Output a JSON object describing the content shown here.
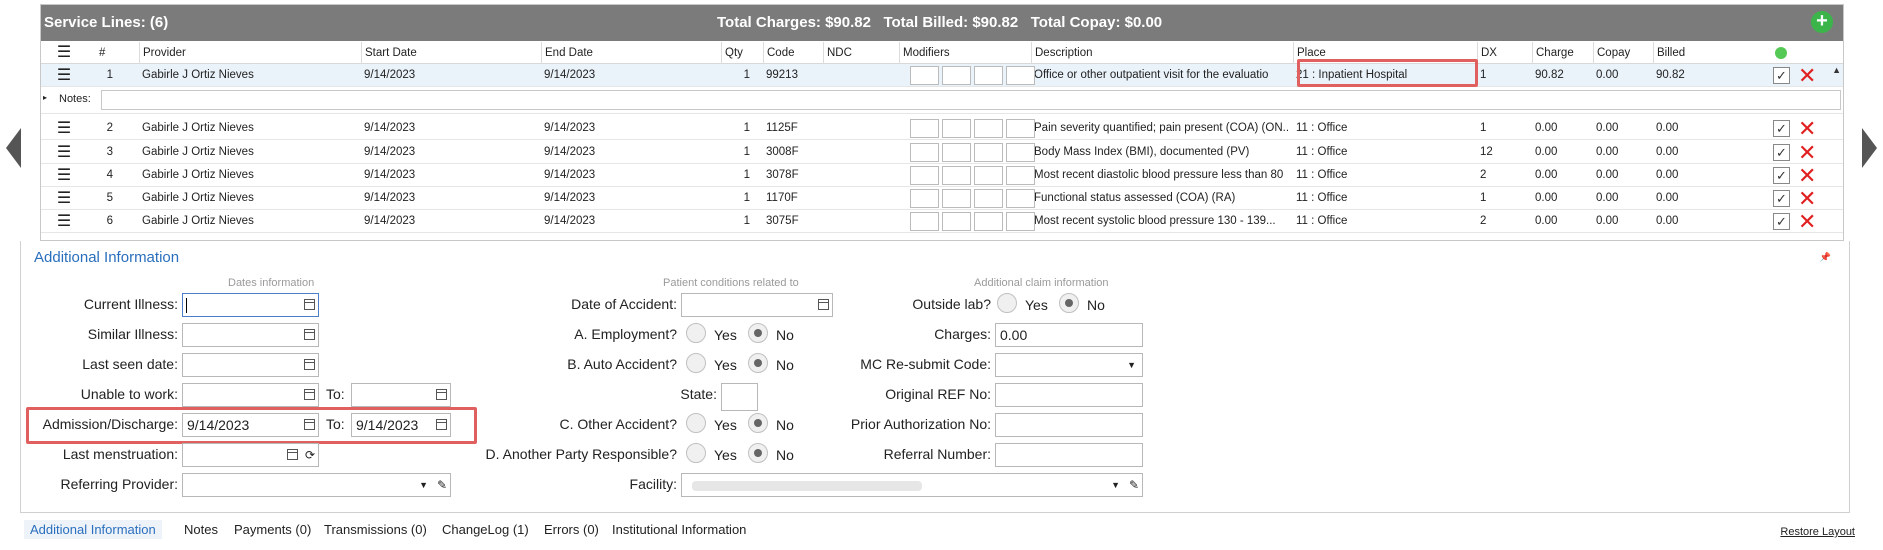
{
  "service_lines": {
    "title": "Service Lines: (6)",
    "totals": "Total Charges: $90.82   Total Billed: $90.82   Total Copay: $0.00",
    "add_symbol": "+",
    "columns": [
      "#",
      "Provider",
      "Start Date",
      "End Date",
      "Qty",
      "Code",
      "NDC",
      "Modifiers",
      "Description",
      "Place",
      "DX",
      "Charge",
      "Copay",
      "Billed"
    ],
    "notes_label": "Notes:",
    "rows": [
      {
        "num": "1",
        "provider": "Gabirle J Ortiz Nieves",
        "start": "9/14/2023",
        "end": "9/14/2023",
        "qty": "1",
        "code": "99213",
        "ndc": "",
        "description": "Office or other outpatient visit for the evaluatio",
        "place": "21 : Inpatient Hospital",
        "dx": "1",
        "charge": "90.82",
        "copay": "0.00",
        "billed": "90.82"
      },
      {
        "num": "2",
        "provider": "Gabirle J Ortiz Nieves",
        "start": "9/14/2023",
        "end": "9/14/2023",
        "qty": "1",
        "code": "1125F",
        "ndc": "",
        "description": "Pain severity quantified; pain present (COA) (ON...",
        "place": "11 : Office",
        "dx": "1",
        "charge": "0.00",
        "copay": "0.00",
        "billed": "0.00"
      },
      {
        "num": "3",
        "provider": "Gabirle J Ortiz Nieves",
        "start": "9/14/2023",
        "end": "9/14/2023",
        "qty": "1",
        "code": "3008F",
        "ndc": "",
        "description": "Body Mass Index (BMI), documented (PV)",
        "place": "11 : Office",
        "dx": "12",
        "charge": "0.00",
        "copay": "0.00",
        "billed": "0.00"
      },
      {
        "num": "4",
        "provider": "Gabirle J Ortiz Nieves",
        "start": "9/14/2023",
        "end": "9/14/2023",
        "qty": "1",
        "code": "3078F",
        "ndc": "",
        "description": "Most recent diastolic blood pressure less than 80",
        "place": "11 : Office",
        "dx": "2",
        "charge": "0.00",
        "copay": "0.00",
        "billed": "0.00"
      },
      {
        "num": "5",
        "provider": "Gabirle J Ortiz Nieves",
        "start": "9/14/2023",
        "end": "9/14/2023",
        "qty": "1",
        "code": "1170F",
        "ndc": "",
        "description": "Functional status assessed (COA) (RA)",
        "place": "11 : Office",
        "dx": "1",
        "charge": "0.00",
        "copay": "0.00",
        "billed": "0.00"
      },
      {
        "num": "6",
        "provider": "Gabirle J Ortiz Nieves",
        "start": "9/14/2023",
        "end": "9/14/2023",
        "qty": "1",
        "code": "3075F",
        "ndc": "",
        "description": "Most recent systolic blood pressure 130 - 139...",
        "place": "11 : Office",
        "dx": "2",
        "charge": "0.00",
        "copay": "0.00",
        "billed": "0.00"
      }
    ]
  },
  "additional": {
    "title": "Additional Information",
    "dates_caption": "Dates information",
    "patient_caption": "Patient conditions related to",
    "claim_caption": "Additional claim information",
    "current_illness": "Current Illness:",
    "similar_illness": "Similar Illness:",
    "last_seen": "Last seen date:",
    "unable_to_work": "Unable to work:",
    "admission": "Admission/Discharge:",
    "admission_from": "9/14/2023",
    "admission_to": "9/14/2023",
    "to": "To:",
    "last_menstruation": "Last menstruation:",
    "referring_provider": "Referring Provider:",
    "date_of_accident": "Date of Accident:",
    "employment": "A. Employment?",
    "auto_accident": "B. Auto Accident?",
    "state": "State:",
    "other_accident": "C. Other Accident?",
    "another_party": "D. Another Party Responsible?",
    "facility": "Facility:",
    "outside_lab": "Outside lab?",
    "charges": "Charges:",
    "charges_value": "0.00",
    "mc_resubmit": "MC Re-submit Code:",
    "original_ref": "Original REF No:",
    "prior_auth": "Prior Authorization No:",
    "referral_number": "Referral Number:",
    "yes": "Yes",
    "no": "No"
  },
  "tabs": [
    "Additional Information",
    "Notes",
    "Payments (0)",
    "Transmissions (0)",
    "ChangeLog (1)",
    "Errors (0)",
    "Institutional Information"
  ],
  "restore_layout": "Restore Layout",
  "colors": {
    "header_bg": "#7b7b7b",
    "accent": "#2a6fbd",
    "highlight": "#e06060",
    "delete": "#e02020"
  }
}
